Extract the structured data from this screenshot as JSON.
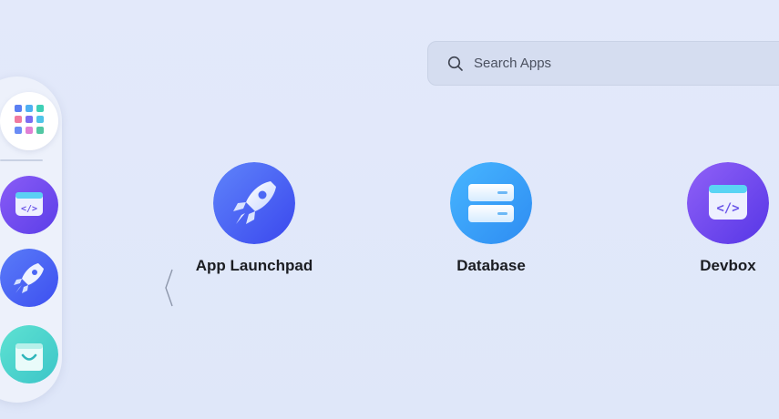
{
  "search": {
    "placeholder": "Search Apps",
    "icon": "search-icon"
  },
  "dock": {
    "items": [
      {
        "name": "app-grid",
        "icon": "app-grid-icon"
      },
      {
        "name": "devbox",
        "icon": "devbox-icon"
      },
      {
        "name": "app-launchpad",
        "icon": "rocket-icon"
      },
      {
        "name": "app-store",
        "icon": "shopping-bag-icon"
      }
    ]
  },
  "apps": [
    {
      "label": "App Launchpad",
      "icon": "rocket-icon",
      "color": "#4a66f5"
    },
    {
      "label": "Database",
      "icon": "database-icon",
      "color": "#3a9ef8"
    },
    {
      "label": "Devbox",
      "icon": "devbox-icon",
      "color": "#6c4cf0"
    }
  ],
  "nav": {
    "prev_icon": "chevron-left-icon"
  },
  "colors": {
    "background": "#e1e8f9",
    "search_bg": "#d5ddf0",
    "dock_bg": "#edf1fb",
    "label_text": "#1b1d22"
  }
}
